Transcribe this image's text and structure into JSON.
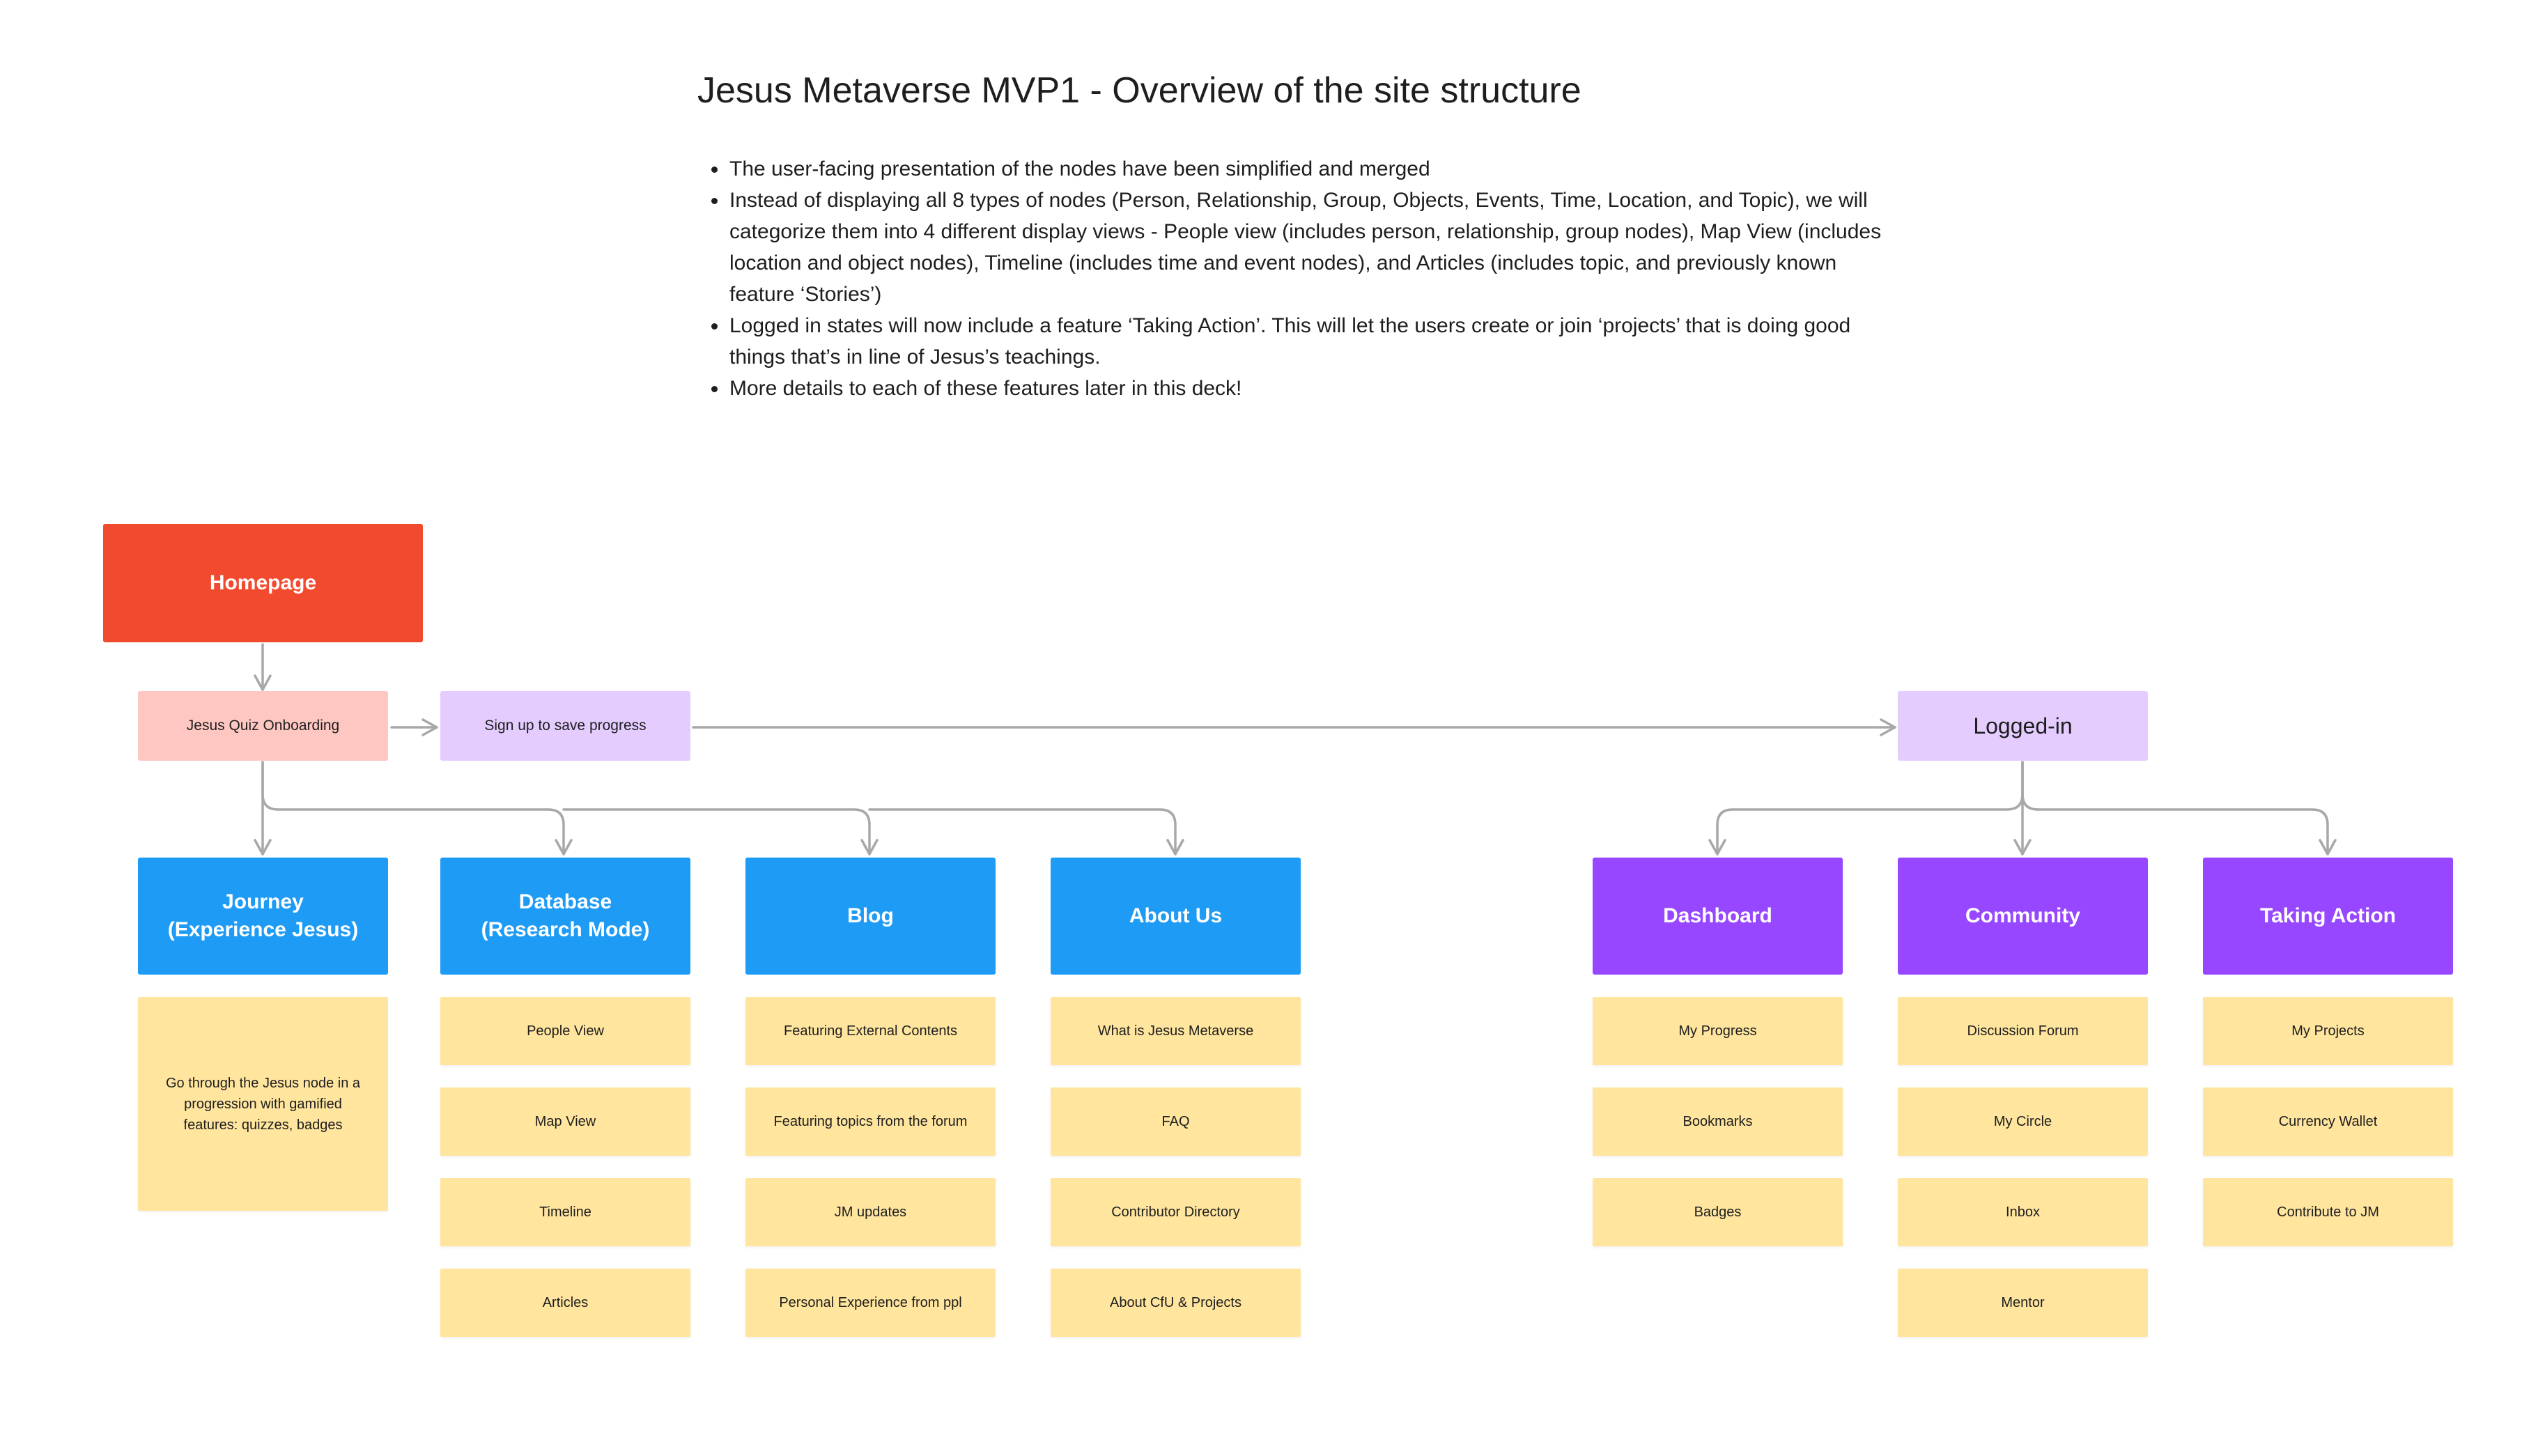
{
  "title": "Jesus Metaverse MVP1 - Overview of the site structure",
  "notes": [
    "The user-facing presentation of the nodes have been simplified and merged",
    "Instead of displaying all 8 types of nodes (Person, Relationship, Group, Objects, Events, Time, Location, and Topic), we will categorize them into 4 different display views - People view (includes person, relationship, group nodes), Map View (includes location and object nodes), Timeline (includes time and event nodes), and Articles (includes topic, and previously known feature ‘Stories’)",
    "Logged in states will now include a feature ‘Taking Action’. This will let the users create or join ‘projects’ that is doing good things that’s in line of Jesus’s teachings.",
    "More details to each of these features later in this deck!"
  ],
  "nodes": {
    "homepage": "Homepage",
    "quiz_onboarding": "Jesus Quiz Onboarding",
    "signup": "Sign up to save progress",
    "logged_in": "Logged-in"
  },
  "sections": {
    "journey": {
      "title_line1": "Journey",
      "title_line2": "(Experience Jesus)",
      "note": "Go through the Jesus node in a progression with gamified features: quizzes, badges"
    },
    "database": {
      "title_line1": "Database",
      "title_line2": "(Research Mode)",
      "items": [
        "People View",
        "Map View",
        "Timeline",
        "Articles"
      ]
    },
    "blog": {
      "title": "Blog",
      "items": [
        "Featuring External Contents",
        "Featuring topics from the forum",
        "JM updates",
        "Personal Experience from ppl"
      ]
    },
    "about": {
      "title": "About Us",
      "items": [
        "What is Jesus Metaverse",
        "FAQ",
        "Contributor Directory",
        "About CfU & Projects"
      ]
    },
    "dashboard": {
      "title": "Dashboard",
      "items": [
        "My Progress",
        "Bookmarks",
        "Badges"
      ]
    },
    "community": {
      "title": "Community",
      "items": [
        "Discussion Forum",
        "My Circle",
        "Inbox",
        "Mentor"
      ]
    },
    "taking_action": {
      "title": "Taking Action",
      "items": [
        "My Projects",
        "Currency Wallet",
        "Contribute to JM"
      ]
    }
  },
  "colors": {
    "homepage": "#f24a2e",
    "onboarding": "#ffc7c2",
    "signup": "#e4ccff",
    "public_sections": "#1e9bf5",
    "logged_in_sections": "#9747ff",
    "sticky_notes": "#ffe59e",
    "connectors": "#a8a8a8"
  }
}
